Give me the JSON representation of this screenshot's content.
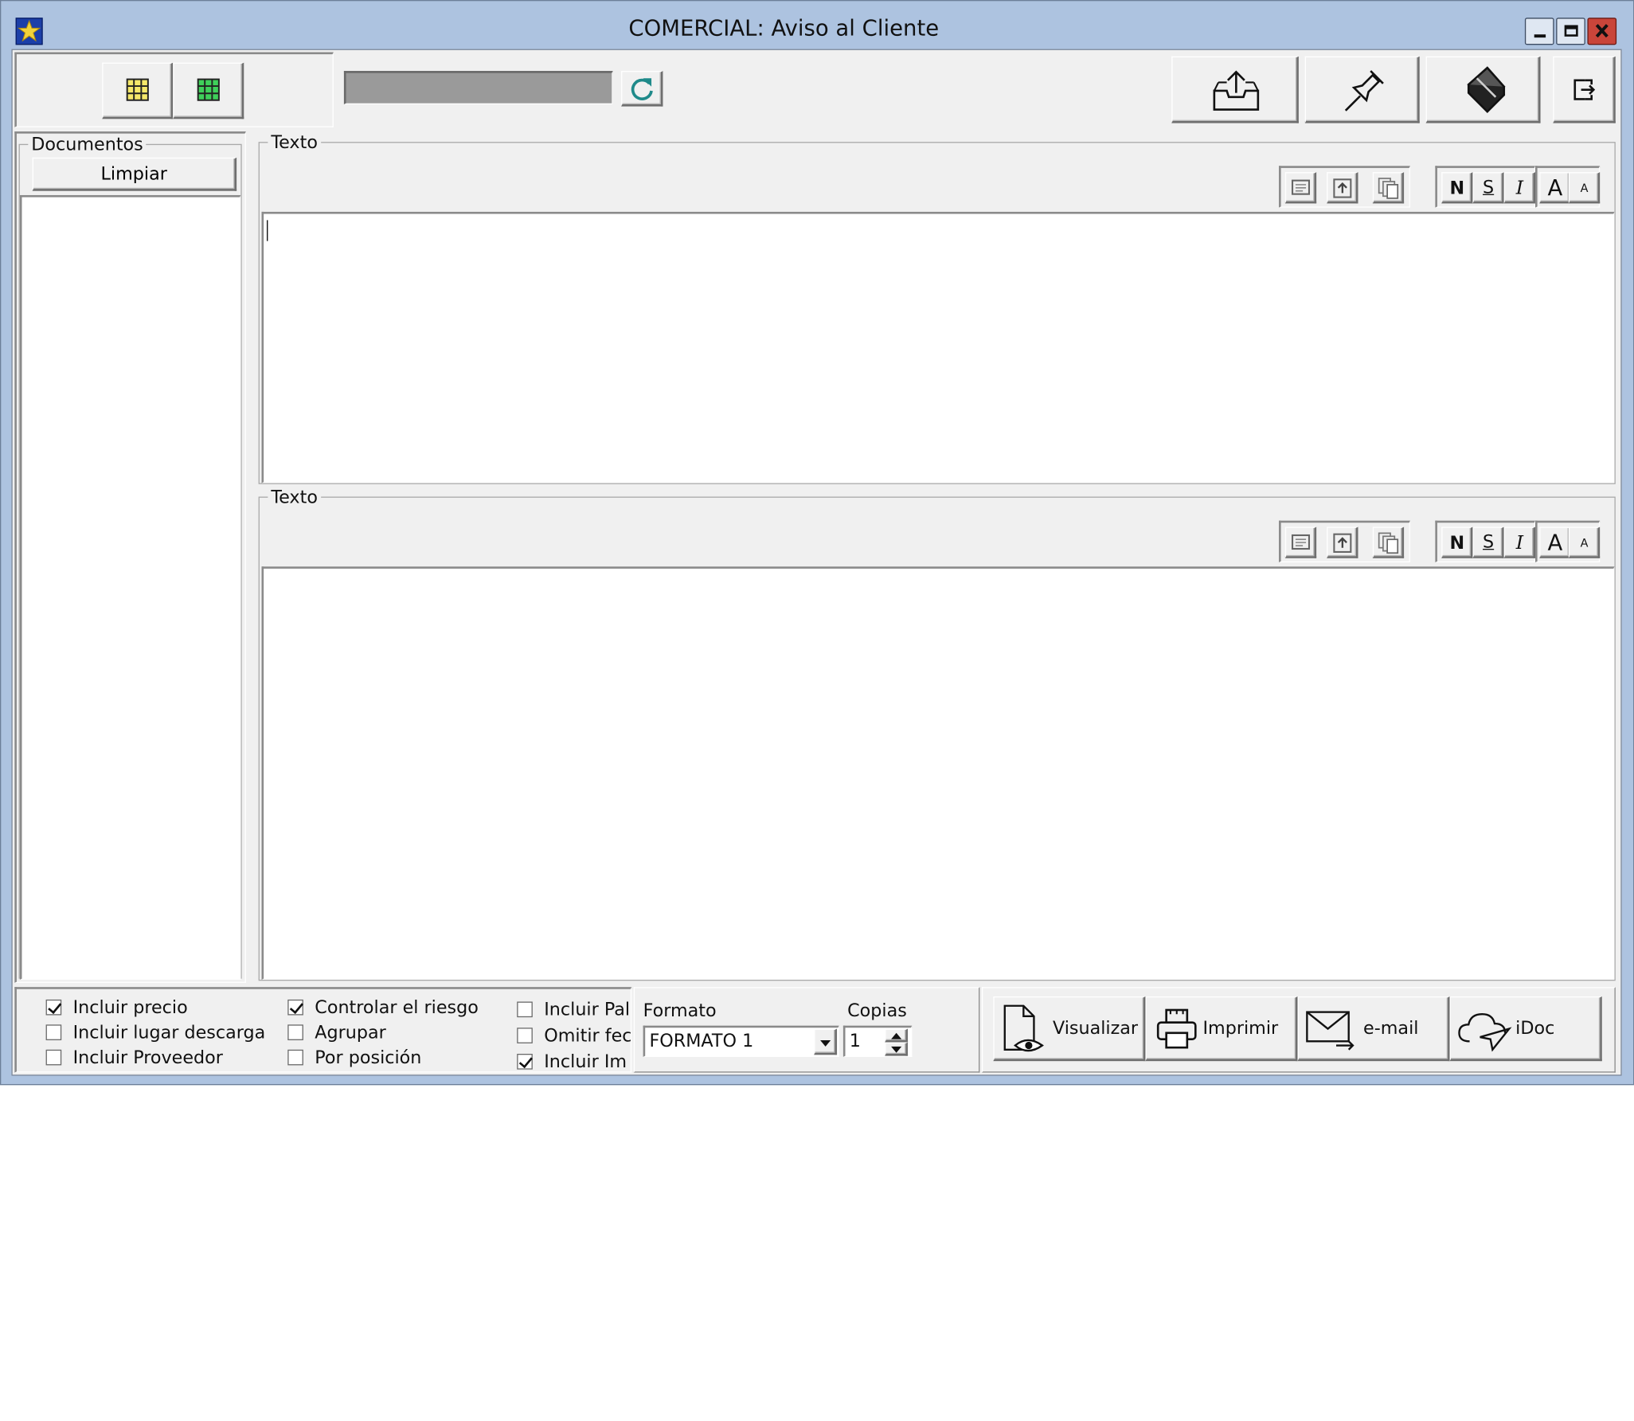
{
  "window": {
    "title": "COMERCIAL: Aviso al Cliente"
  },
  "toolbar": {
    "grid_yellow_icon": "grid-icon",
    "grid_green_icon": "grid-icon",
    "refresh_icon": "refresh-icon"
  },
  "documentos": {
    "legend": "Documentos",
    "clear_label": "Limpiar"
  },
  "texto_top": {
    "legend": "Texto"
  },
  "texto_bottom": {
    "legend": "Texto"
  },
  "format_buttons": {
    "bold": "N",
    "underline": "S",
    "italic": "I",
    "grow": "A",
    "shrink": "A"
  },
  "options": {
    "col1": [
      {
        "label": "Incluir precio",
        "checked": true
      },
      {
        "label": "Incluir lugar descarga",
        "checked": false
      },
      {
        "label": "Incluir Proveedor",
        "checked": false
      }
    ],
    "col2": [
      {
        "label": "Controlar el riesgo",
        "checked": true
      },
      {
        "label": "Agrupar",
        "checked": false
      },
      {
        "label": "Por posición",
        "checked": false
      }
    ],
    "col3": [
      {
        "label": "Incluir Pal",
        "checked": false
      },
      {
        "label": "Omitir fec",
        "checked": false
      },
      {
        "label": "Incluir Im",
        "checked": true
      }
    ]
  },
  "formato": {
    "label": "Formato",
    "value": "FORMATO 1"
  },
  "copias": {
    "label": "Copias",
    "value": "1"
  },
  "actions": {
    "visualizar": "Visualizar",
    "imprimir": "Imprimir",
    "email": "e-mail",
    "idoc": "iDoc"
  },
  "colors": {
    "title_bar": "#adc3e0",
    "close_button": "#c9453a",
    "face": "#f0f0f0",
    "progress": "#9a9a9a"
  }
}
